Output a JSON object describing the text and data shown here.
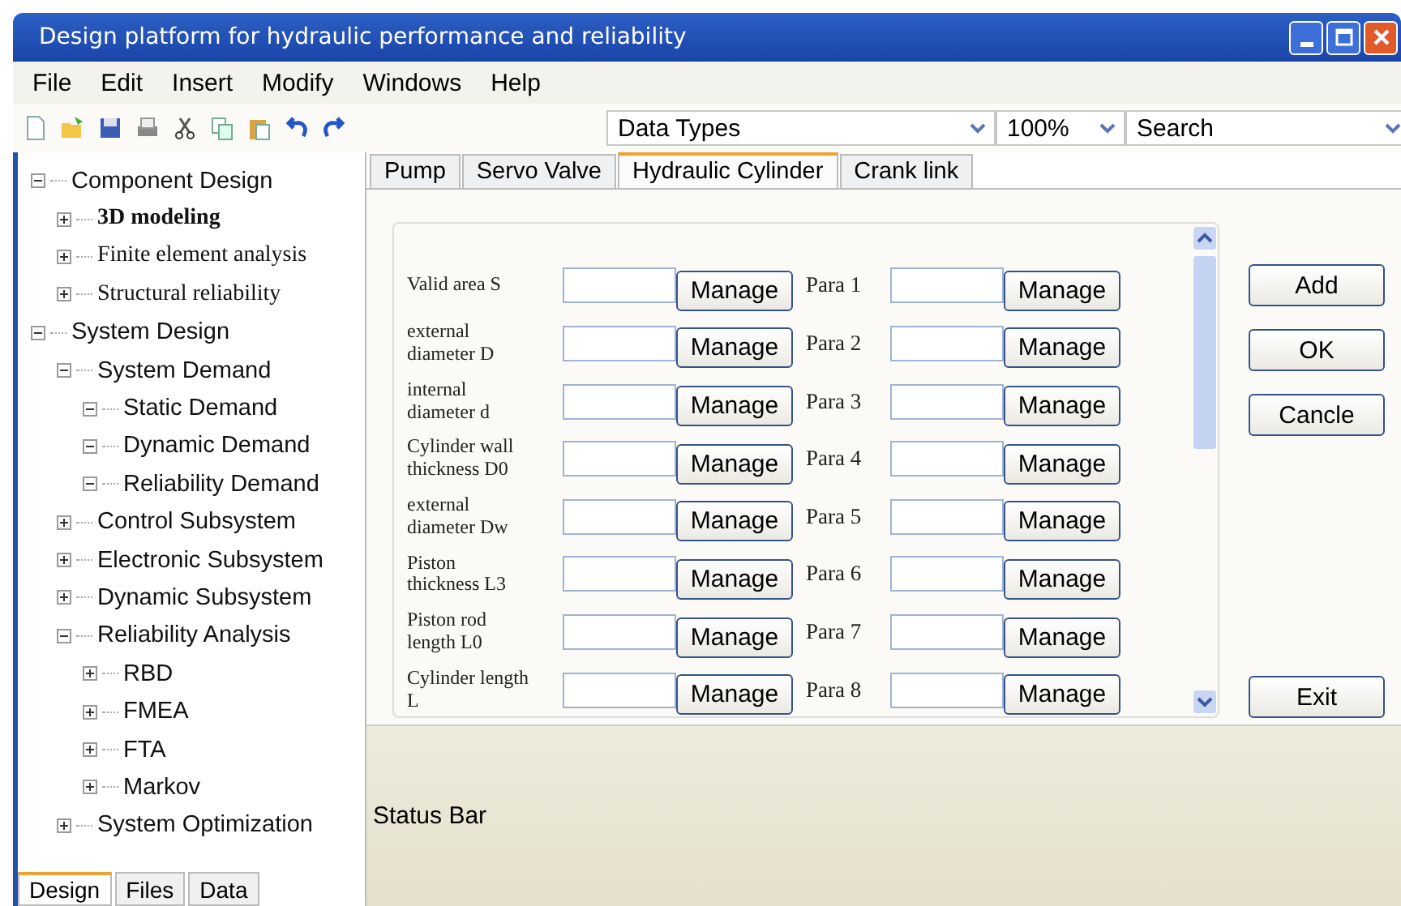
{
  "window": {
    "title": "Design platform for hydraulic performance and reliability"
  },
  "menu": [
    "File",
    "Edit",
    "Insert",
    "Modify",
    "Windows",
    "Help"
  ],
  "toolbar": {
    "tools": [
      {
        "kind": "new"
      },
      {
        "kind": "open"
      },
      {
        "kind": "save"
      },
      {
        "kind": "print"
      },
      {
        "kind": "cut"
      },
      {
        "kind": "copy"
      },
      {
        "kind": "paste"
      },
      {
        "kind": "undo"
      },
      {
        "kind": "redo"
      }
    ],
    "dropdowns": [
      {
        "value": "Data Types"
      },
      {
        "value": "100%"
      },
      {
        "value": "Search"
      }
    ]
  },
  "tree": [
    {
      "label": "Component Design",
      "kind": "plain",
      "expanded": true,
      "children": [
        {
          "label": "3D modeling",
          "kind": "strong",
          "expanded": false
        },
        {
          "label": "Finite element analysis",
          "kind": "serif",
          "expanded": false
        },
        {
          "label": "Structural reliability",
          "kind": "serif",
          "expanded": false
        }
      ]
    },
    {
      "label": "System Design",
      "kind": "plain",
      "expanded": true,
      "children": [
        {
          "label": "System Demand",
          "kind": "plain",
          "expanded": true,
          "children": [
            {
              "label": "Static Demand",
              "kind": "plain",
              "expanded": true
            },
            {
              "label": "Dynamic Demand",
              "kind": "plain",
              "expanded": true
            },
            {
              "label": "Reliability Demand",
              "kind": "plain",
              "expanded": true
            }
          ]
        },
        {
          "label": "Control Subsystem",
          "kind": "plain",
          "expanded": false
        },
        {
          "label": "Electronic Subsystem",
          "kind": "plain",
          "expanded": false
        },
        {
          "label": "Dynamic Subsystem",
          "kind": "plain",
          "expanded": false
        },
        {
          "label": "Reliability Analysis",
          "kind": "plain",
          "expanded": true,
          "children": [
            {
              "label": "RBD",
              "kind": "plain",
              "expanded": false
            },
            {
              "label": "FMEA",
              "kind": "plain",
              "expanded": false
            },
            {
              "label": "FTA",
              "kind": "plain",
              "expanded": false
            },
            {
              "label": "Markov",
              "kind": "plain",
              "expanded": false
            }
          ]
        },
        {
          "label": "System Optimization",
          "kind": "plain",
          "expanded": false
        }
      ]
    }
  ],
  "panel_tabs": [
    {
      "label": "Design",
      "selected": true
    },
    {
      "label": "Files",
      "selected": false
    },
    {
      "label": "Data",
      "selected": false
    }
  ],
  "tabs": [
    {
      "label": "Pump",
      "selected": false
    },
    {
      "label": "Servo Valve",
      "selected": false
    },
    {
      "label": "Hydraulic Cylinder",
      "selected": true
    },
    {
      "label": "Crank link",
      "selected": false
    }
  ],
  "rows": [
    {
      "label": "Valid area S",
      "button": "Manage",
      "para": "Para 1",
      "para_button": "Manage"
    },
    {
      "label": "external diameter D",
      "button": "Manage",
      "para": "Para 2",
      "para_button": "Manage"
    },
    {
      "label": "internal diameter d",
      "button": "Manage",
      "para": "Para 3",
      "para_button": "Manage"
    },
    {
      "label": "Cylinder wall thickness D0",
      "button": "Manage",
      "para": "Para 4",
      "para_button": "Manage"
    },
    {
      "label": "external diameter Dw",
      "button": "Manage",
      "para": "Para 5",
      "para_button": "Manage"
    },
    {
      "label": "Piston thickness L3",
      "button": "Manage",
      "para": "Para 6",
      "para_button": "Manage"
    },
    {
      "label": "Piston rod length L0",
      "button": "Manage",
      "para": "Para 7",
      "para_button": "Manage"
    },
    {
      "label": "Cylinder length L",
      "button": "Manage",
      "para": "Para 8",
      "para_button": "Manage"
    }
  ],
  "actions": [
    "Add",
    "OK",
    "Cancle"
  ],
  "exit_button": "Exit",
  "status_bar": "Status Bar"
}
